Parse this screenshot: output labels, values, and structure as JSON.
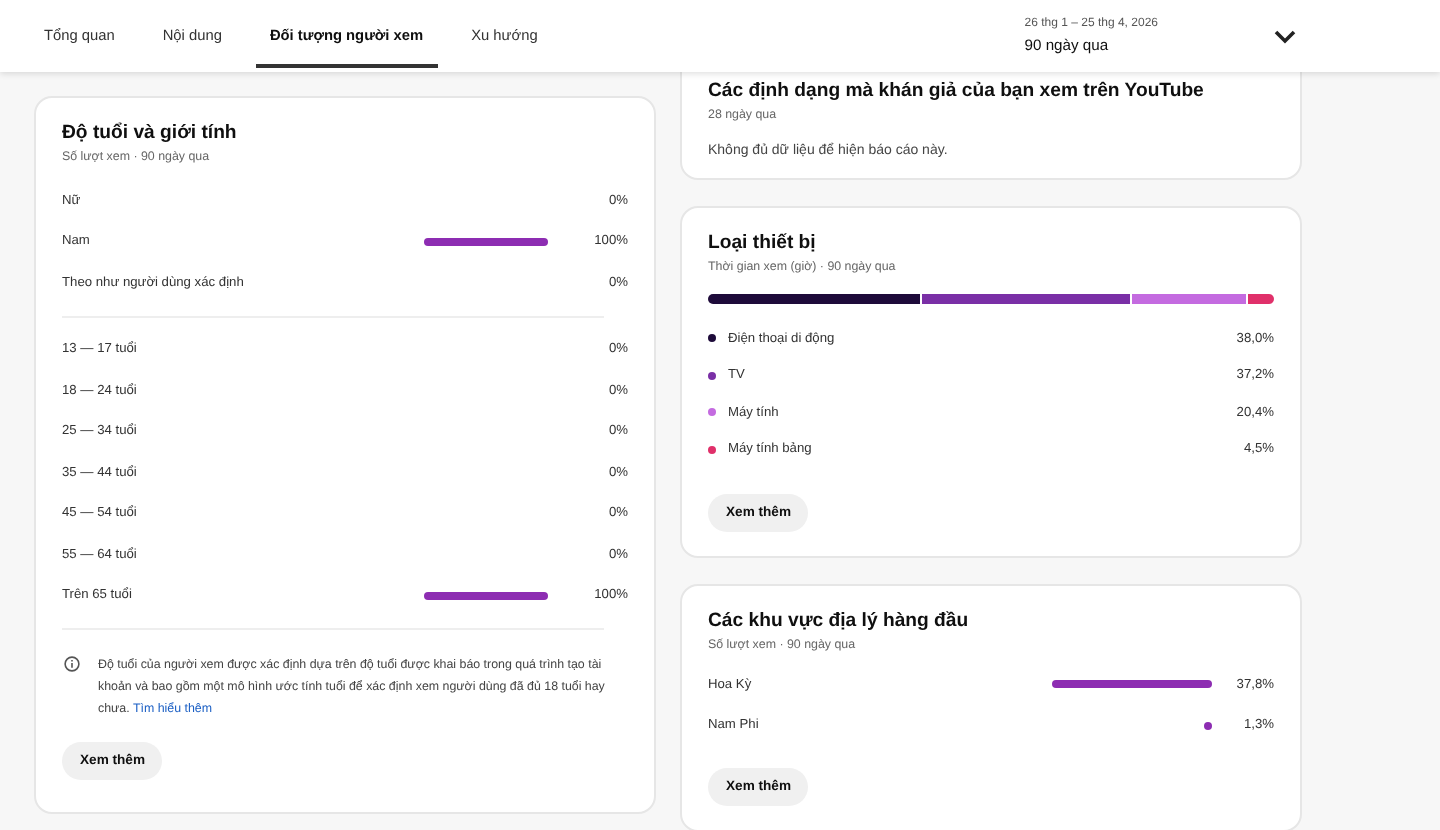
{
  "tabs": [
    {
      "label": "Tổng quan",
      "selected": false
    },
    {
      "label": "Nội dung",
      "selected": false
    },
    {
      "label": "Đối tượng người xem",
      "selected": true
    },
    {
      "label": "Xu hướng",
      "selected": false
    }
  ],
  "date_range": {
    "range": "26 thg 1 – 25 thg 4, 2026",
    "period": "90 ngày qua"
  },
  "age_gender": {
    "title": "Độ tuổi và giới tính",
    "subtitle": "Số lượt xem · 90 ngày qua",
    "gender_rows": [
      {
        "label": "Nữ",
        "value": "0%"
      },
      {
        "label": "Nam",
        "value": "100%"
      },
      {
        "label": "Theo như người dùng xác định",
        "value": "0%"
      }
    ],
    "age_rows": [
      {
        "label": "13 — 17 tuổi",
        "value": "0%"
      },
      {
        "label": "18 — 24 tuổi",
        "value": "0%"
      },
      {
        "label": "25 — 34 tuổi",
        "value": "0%"
      },
      {
        "label": "35 — 44 tuổi",
        "value": "0%"
      },
      {
        "label": "45 — 54 tuổi",
        "value": "0%"
      },
      {
        "label": "55 — 64 tuổi",
        "value": "0%"
      },
      {
        "label": "Trên 65 tuổi",
        "value": "100%"
      }
    ],
    "note": "Độ tuổi của người xem được xác định dựa trên độ tuổi được khai báo trong quá trình tạo tài khoản và bao gồm một mô hình ước tính tuổi để xác định xem người dùng đã đủ 18 tuổi hay chưa.",
    "note_link": "Tìm hiểu thêm",
    "button": "Xem thêm"
  },
  "formats": {
    "title": "Các định dạng mà khán giả của bạn xem trên YouTube",
    "subtitle": "28 ngày qua",
    "message": "Không đủ dữ liệu để hiện báo cáo này."
  },
  "devices": {
    "title": "Loại thiết bị",
    "subtitle": "Thời gian xem (giờ) · 90 ngày qua",
    "items": [
      {
        "label": "Điện thoại di động",
        "value": "38,0%",
        "color": "#1e0b3a"
      },
      {
        "label": "TV",
        "value": "37,2%",
        "color": "#7a2fa6"
      },
      {
        "label": "Máy tính",
        "value": "20,4%",
        "color": "#c46be0"
      },
      {
        "label": "Máy tính bảng",
        "value": "4,5%",
        "color": "#e0306a"
      }
    ],
    "button": "Xem thêm"
  },
  "geography": {
    "title": "Các khu vực địa lý hàng đầu",
    "subtitle": "Số lượt xem · 90 ngày qua",
    "rows": [
      {
        "label": "Hoa Kỳ",
        "value": "37,8%"
      },
      {
        "label": "Nam Phi",
        "value": "1,3%"
      }
    ],
    "button": "Xem thêm"
  }
}
